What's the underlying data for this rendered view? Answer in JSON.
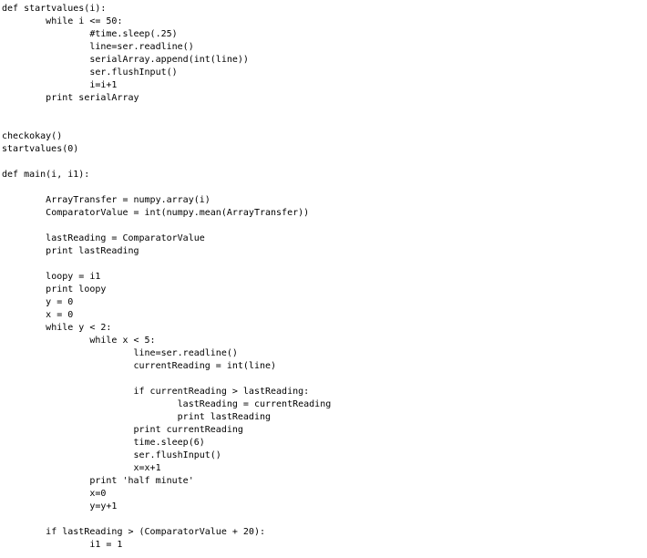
{
  "document": {
    "lines": [
      "def startvalues(i):",
      "\twhile i <= 50:",
      "\t\t#time.sleep(.25)",
      "\t\tline=ser.readline()",
      "\t\tserialArray.append(int(line))",
      "\t\tser.flushInput()",
      "\t\ti=i+1",
      "\tprint serialArray",
      "",
      "",
      "checkokay()",
      "startvalues(0)",
      "",
      "def main(i, i1):",
      "",
      "\tArrayTransfer = numpy.array(i)",
      "\tComparatorValue = int(numpy.mean(ArrayTransfer))",
      "",
      "\tlastReading = ComparatorValue",
      "\tprint lastReading",
      "",
      "\tloopy = i1",
      "\tprint loopy",
      "\ty = 0",
      "\tx = 0",
      "\twhile y < 2:",
      "\t\twhile x < 5:",
      "\t\t\tline=ser.readline()",
      "\t\t\tcurrentReading = int(line)",
      "",
      "\t\t\tif currentReading > lastReading:",
      "\t\t\t\tlastReading = currentReading",
      "\t\t\t\tprint lastReading",
      "\t\t\tprint currentReading",
      "\t\t\ttime.sleep(6)",
      "\t\t\tser.flushInput()",
      "\t\t\tx=x+1",
      "\t\tprint 'half minute'",
      "\t\tx=0",
      "\t\ty=y+1",
      "",
      "\tif lastReading > (ComparatorValue + 20):",
      "\t\ti1 = 1"
    ]
  }
}
